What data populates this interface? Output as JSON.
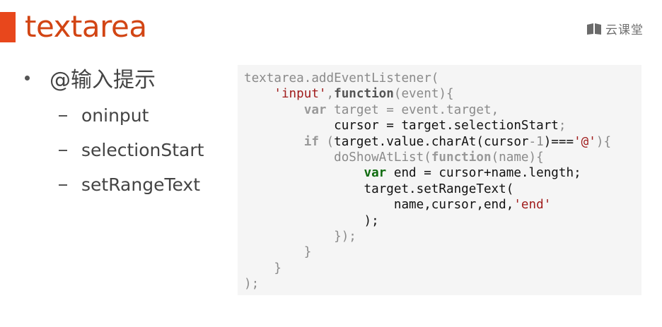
{
  "slide": {
    "title": "textarea",
    "accent_color": "#e8471c",
    "title_color": "#d24514"
  },
  "brand": {
    "text": "云课堂",
    "icon": "book-icon"
  },
  "bullets": {
    "main": "@输入提示",
    "sub": [
      "oninput",
      "selectionStart",
      "setRangeText"
    ]
  },
  "code": {
    "lines": [
      [
        {
          "t": "textarea.addEventListener(",
          "c": "t-dim"
        }
      ],
      [
        {
          "t": "    ",
          "c": ""
        },
        {
          "t": "'input'",
          "c": "t-str"
        },
        {
          "t": ",",
          "c": "t-dim"
        },
        {
          "t": "function",
          "c": "t-kw"
        },
        {
          "t": "(event){",
          "c": "t-dim"
        }
      ],
      [
        {
          "t": "        ",
          "c": ""
        },
        {
          "t": "var",
          "c": "t-kwdim"
        },
        {
          "t": " target = event.target,",
          "c": "t-dim"
        }
      ],
      [
        {
          "t": "            cursor = target.selectionStart",
          "c": ""
        },
        {
          "t": ";",
          "c": "t-dim"
        }
      ],
      [
        {
          "t": "        ",
          "c": ""
        },
        {
          "t": "if",
          "c": "t-kwdim"
        },
        {
          "t": " (",
          "c": "t-dim"
        },
        {
          "t": "target.value.charAt(cursor",
          "c": ""
        },
        {
          "t": "-1",
          "c": "t-dim"
        },
        {
          "t": ")===",
          "c": ""
        },
        {
          "t": "'@'",
          "c": "t-str"
        },
        {
          "t": "){",
          "c": "t-dim"
        }
      ],
      [
        {
          "t": "            doShowAtList(",
          "c": "t-dim"
        },
        {
          "t": "function",
          "c": "t-kwdim"
        },
        {
          "t": "(name){",
          "c": "t-dim"
        }
      ],
      [
        {
          "t": "                ",
          "c": ""
        },
        {
          "t": "var",
          "c": "t-kwgreen"
        },
        {
          "t": " end = cursor+name.length;",
          "c": ""
        }
      ],
      [
        {
          "t": "                target.setRangeText(",
          "c": ""
        }
      ],
      [
        {
          "t": "                    name,cursor,end,",
          "c": ""
        },
        {
          "t": "'end'",
          "c": "t-str"
        }
      ],
      [
        {
          "t": "                );",
          "c": ""
        }
      ],
      [
        {
          "t": "            });",
          "c": "t-dim"
        }
      ],
      [
        {
          "t": "        }",
          "c": "t-dim"
        }
      ],
      [
        {
          "t": "    }",
          "c": "t-dim"
        }
      ],
      [
        {
          "t": ");",
          "c": "t-dim"
        }
      ]
    ]
  }
}
